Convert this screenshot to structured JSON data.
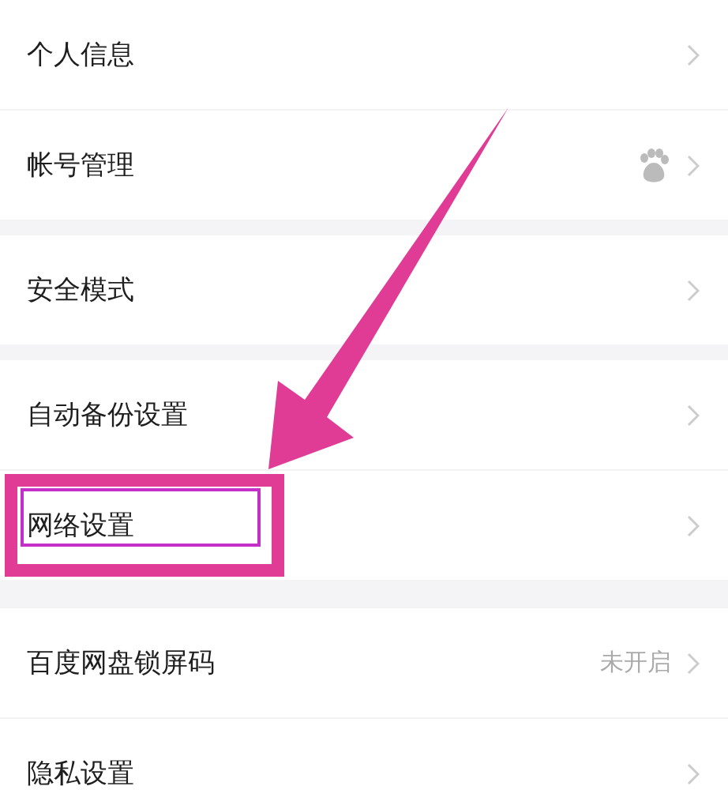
{
  "groups": [
    {
      "items": [
        {
          "kind": "plain",
          "label": "个人信息",
          "highlighted": false
        },
        {
          "kind": "icon",
          "label": "帐号管理",
          "highlighted": false
        }
      ]
    },
    {
      "items": [
        {
          "kind": "plain",
          "label": "安全模式",
          "highlighted": false
        }
      ]
    },
    {
      "items": [
        {
          "kind": "plain",
          "label": "自动备份设置",
          "highlighted": false
        },
        {
          "kind": "plain",
          "label": "网络设置",
          "highlighted": true
        }
      ]
    },
    {
      "items": [
        {
          "kind": "value",
          "label": "百度网盘锁屏码",
          "value": "未开启",
          "highlighted": false
        },
        {
          "kind": "plain",
          "label": "隐私设置",
          "highlighted": false
        }
      ]
    }
  ]
}
